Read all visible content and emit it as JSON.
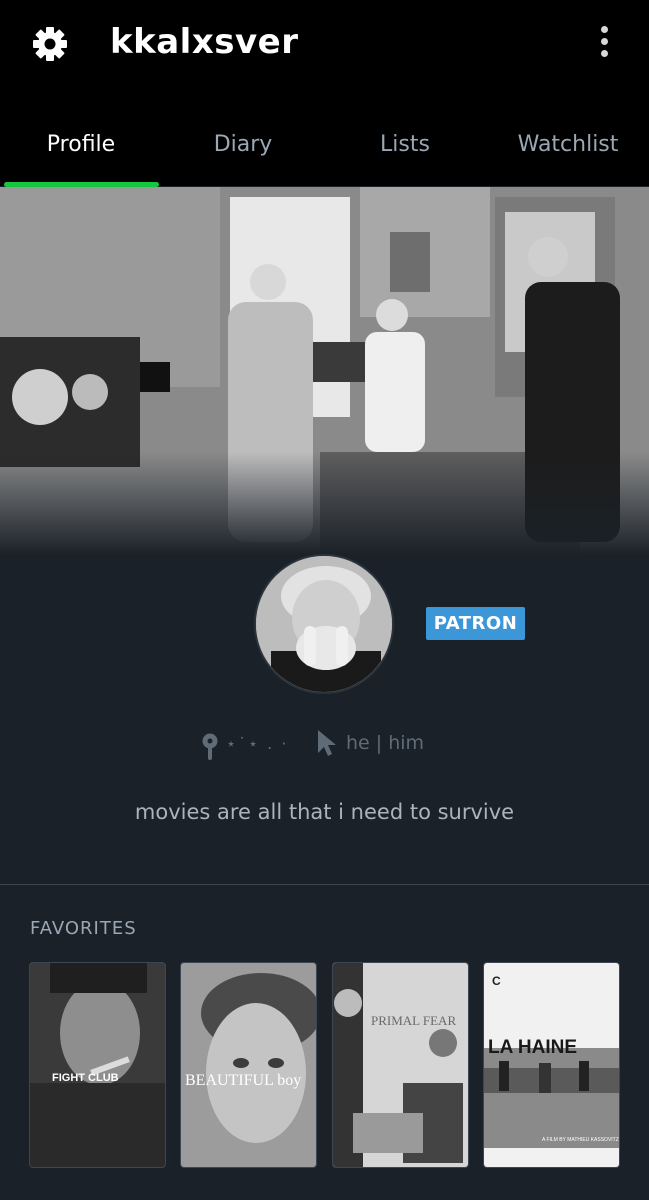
{
  "header": {
    "username": "kkalxsver",
    "settings_icon": "gear-icon",
    "menu_icon": "more-vertical-icon"
  },
  "tabs": [
    {
      "label": "Profile",
      "active": true
    },
    {
      "label": "Diary",
      "active": false
    },
    {
      "label": "Lists",
      "active": false
    },
    {
      "label": "Watchlist",
      "active": false
    }
  ],
  "profile": {
    "badge": "PATRON",
    "location": "⋆˙⋆ . ·",
    "pronouns": "he | him",
    "bio": "movies are all that i need to survive"
  },
  "favorites": {
    "title": "FAVORITES",
    "posters": [
      {
        "title": "FIGHT CLUB"
      },
      {
        "title": "BEAUTIFUL boy"
      },
      {
        "title": "PRIMAL FEAR"
      },
      {
        "title": "LA HAINE",
        "credit": "A FILM BY MATHIEU KASSOVITZ"
      }
    ]
  },
  "colors": {
    "accent": "#16c641",
    "patron": "#3c97d8",
    "background": "#1b2128"
  }
}
